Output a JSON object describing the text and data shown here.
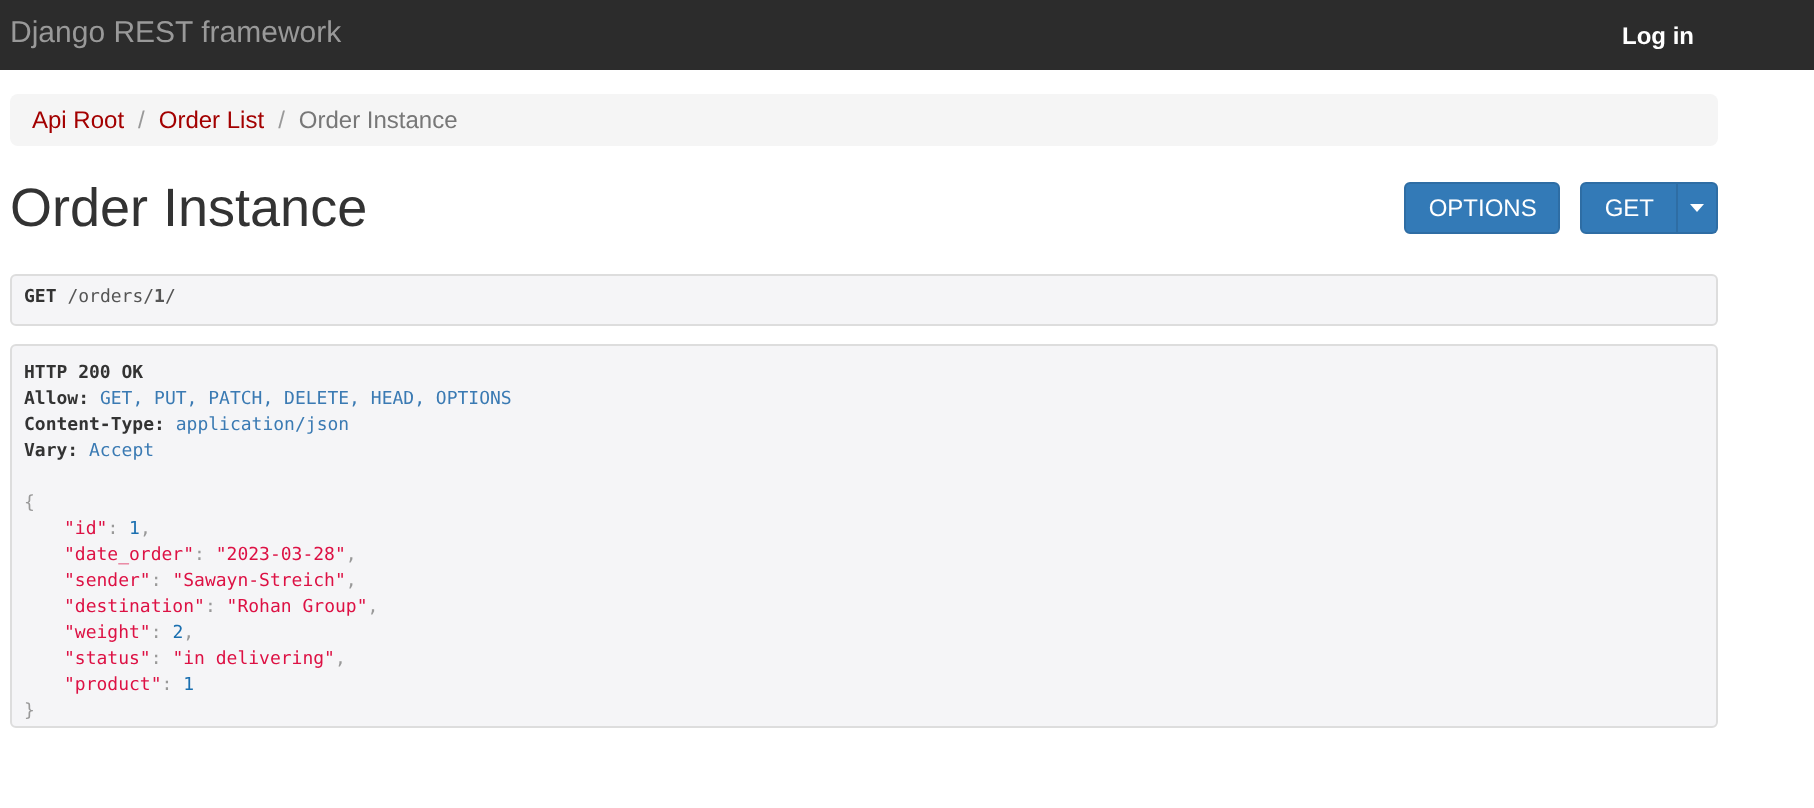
{
  "navbar": {
    "brand": "Django REST framework",
    "login": "Log in"
  },
  "breadcrumbs": [
    {
      "label": "Api Root",
      "active": false
    },
    {
      "label": "Order List",
      "active": false
    },
    {
      "label": "Order Instance",
      "active": true
    }
  ],
  "breadcrumb_separator": "/",
  "title": "Order Instance",
  "buttons": {
    "options": "OPTIONS",
    "get": "GET"
  },
  "request": {
    "method": "GET",
    "path": "/orders/**1**/"
  },
  "response": {
    "status": "HTTP 200 OK",
    "headers": [
      {
        "name": "Allow:",
        "value": "GET, PUT, PATCH, DELETE, HEAD, OPTIONS"
      },
      {
        "name": "Content-Type:",
        "value": "application/json"
      },
      {
        "name": "Vary:",
        "value": "Accept"
      }
    ],
    "open": "{",
    "fields": [
      {
        "key": "\"id\"",
        "colon": ":",
        "value": "1",
        "kind": "number",
        "comma": ","
      },
      {
        "key": "\"date_order\"",
        "colon": ":",
        "value": "\"2023-03-28\"",
        "kind": "string",
        "comma": ","
      },
      {
        "key": "\"sender\"",
        "colon": ":",
        "value": "\"Sawayn-Streich\"",
        "kind": "string",
        "comma": ","
      },
      {
        "key": "\"destination\"",
        "colon": ":",
        "value": "\"Rohan Group\"",
        "kind": "string",
        "comma": ","
      },
      {
        "key": "\"weight\"",
        "colon": ":",
        "value": "2",
        "kind": "number",
        "comma": ","
      },
      {
        "key": "\"status\"",
        "colon": ":",
        "value": "\"in delivering\"",
        "kind": "string",
        "comma": ","
      },
      {
        "key": "\"product\"",
        "colon": ":",
        "value": "1",
        "kind": "number"
      }
    ],
    "close": "}"
  }
}
